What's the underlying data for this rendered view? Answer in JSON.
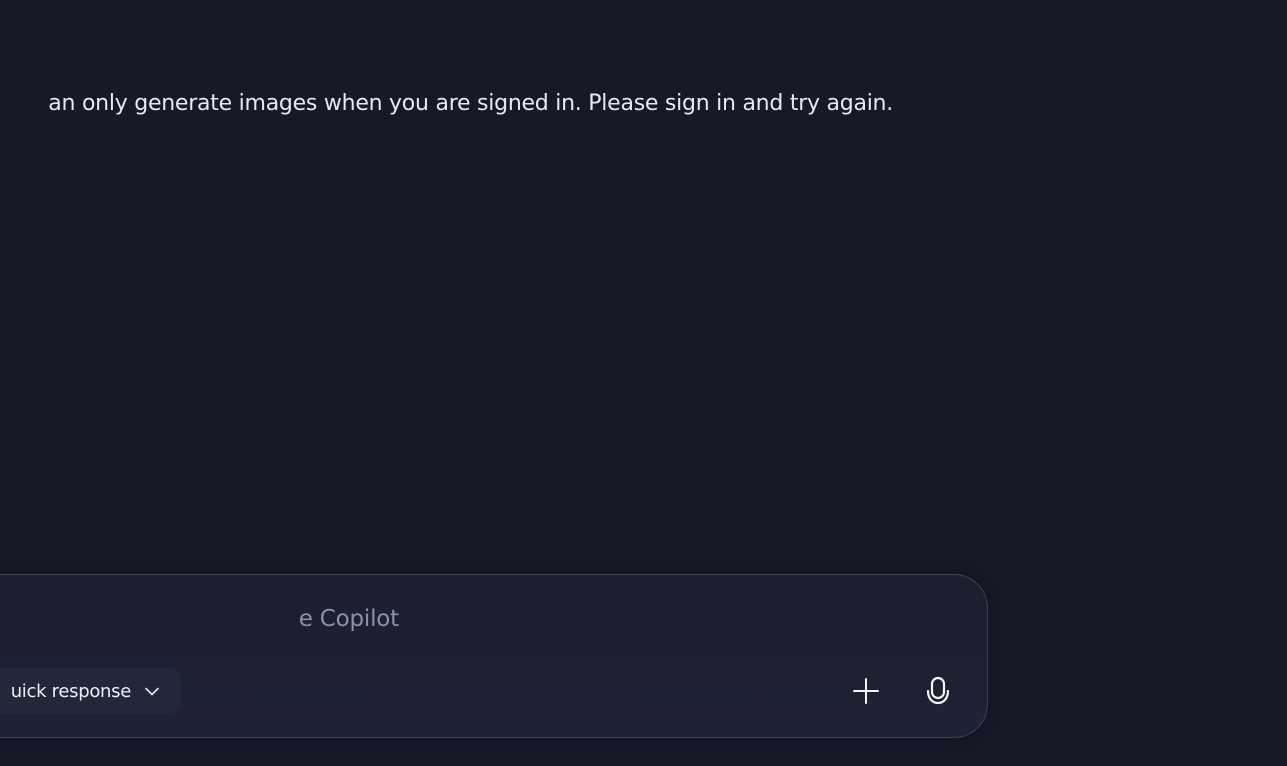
{
  "message": {
    "text": "an only generate images when you are signed in. Please sign in and try again."
  },
  "composer": {
    "placeholder": "e Copilot",
    "mode": {
      "label": "uick response",
      "icon": "chevron-down-icon"
    },
    "buttons": {
      "add_icon": "plus-icon",
      "mic_icon": "microphone-icon"
    }
  },
  "colors": {
    "background": "#161a27",
    "composer": "#1e2235",
    "text": "#e7e9f1",
    "placeholder": "#8c91a8"
  }
}
